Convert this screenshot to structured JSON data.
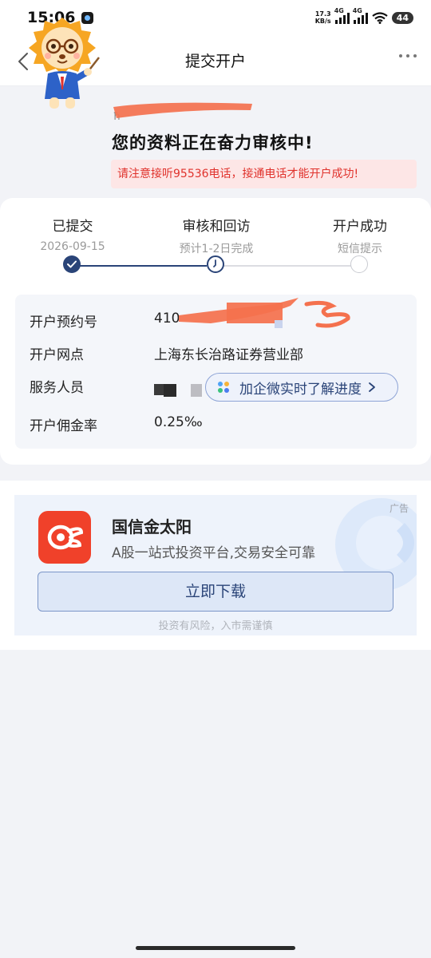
{
  "status_bar": {
    "time": "15:06",
    "net_speed_value": "17.3",
    "net_speed_unit": "KB/s",
    "signal_1_tag": "4G",
    "signal_2_tag": "4G",
    "battery": "44"
  },
  "nav": {
    "back_label": "关闭",
    "title": "提交开户"
  },
  "hero": {
    "masked_text": "ħ",
    "title": "您的资料正在奋力审核中!",
    "notice": "请注意接听95536电话，接通电话才能开户成功!"
  },
  "progress": {
    "steps": [
      {
        "label": "已提交",
        "sub": "2026-09-15"
      },
      {
        "label": "审核和回访",
        "sub": "预计1-2日完成"
      },
      {
        "label": "开户成功",
        "sub": "短信提示"
      }
    ]
  },
  "info": {
    "rows": [
      {
        "key": "开户预约号",
        "value": "410"
      },
      {
        "key": "开户网点",
        "value": "上海东长治路证券营业部"
      },
      {
        "key": "服务人员",
        "value": ""
      },
      {
        "key": "开户佣金率",
        "value": "0.25‰"
      }
    ],
    "wecom_button": "加企微实时了解进度"
  },
  "ad": {
    "tag": "广告",
    "name": "国信金太阳",
    "desc": "A股一站式投资平台,交易安全可靠",
    "button": "立即下载",
    "risk": "投资有风险，入市需谨慎"
  },
  "colors": {
    "accent": "#2a4478",
    "warn": "#e0322c",
    "brand_red": "#f0412a"
  }
}
